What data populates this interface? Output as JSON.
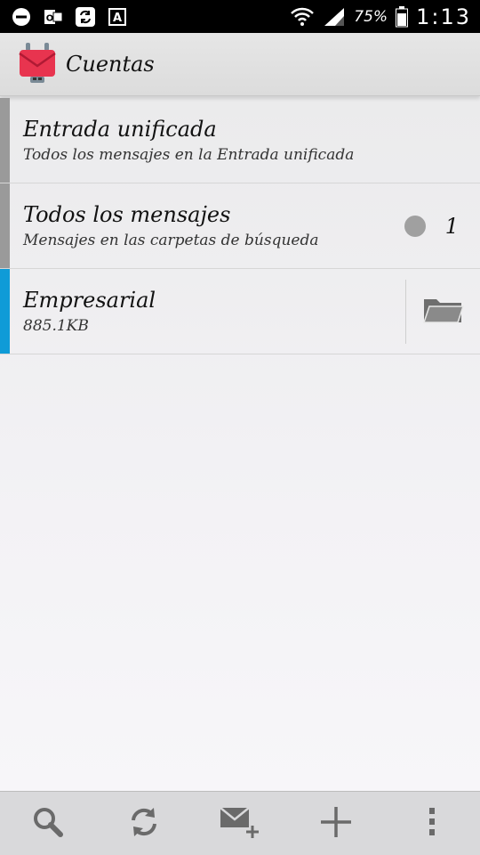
{
  "status_bar": {
    "battery_percent": "75%",
    "time": "1:13",
    "left_icons": [
      "do-not-disturb-icon",
      "outlook-icon",
      "sync-icon",
      "font-a-icon"
    ],
    "right_icons": [
      "wifi-icon",
      "signal-icon",
      "battery-icon"
    ]
  },
  "app_bar": {
    "title": "Cuentas",
    "logo": "k9-mail-logo"
  },
  "accounts": [
    {
      "title": "Entrada unificada",
      "subtitle": "Todos los mensajes en la Entrada unificada",
      "bar_color": "#9a9a9a"
    },
    {
      "title": "Todos los mensajes",
      "subtitle": "Mensajes en las carpetas de búsqueda",
      "bar_color": "#9a9a9a",
      "unread_count": "1"
    },
    {
      "title": "Empresarial",
      "subtitle": "885.1KB",
      "bar_color": "#0f9bd7",
      "action_icon": "folder-icon"
    }
  ],
  "bottom_bar": {
    "buttons": [
      "search-icon",
      "refresh-icon",
      "compose-icon",
      "add-icon",
      "overflow-menu-icon"
    ]
  },
  "colors": {
    "status_bar_bg": "#000000",
    "action_bar_bg": "#e2e2e2",
    "accent_blue": "#0f9bd7",
    "logo_red": "#e8344f"
  }
}
